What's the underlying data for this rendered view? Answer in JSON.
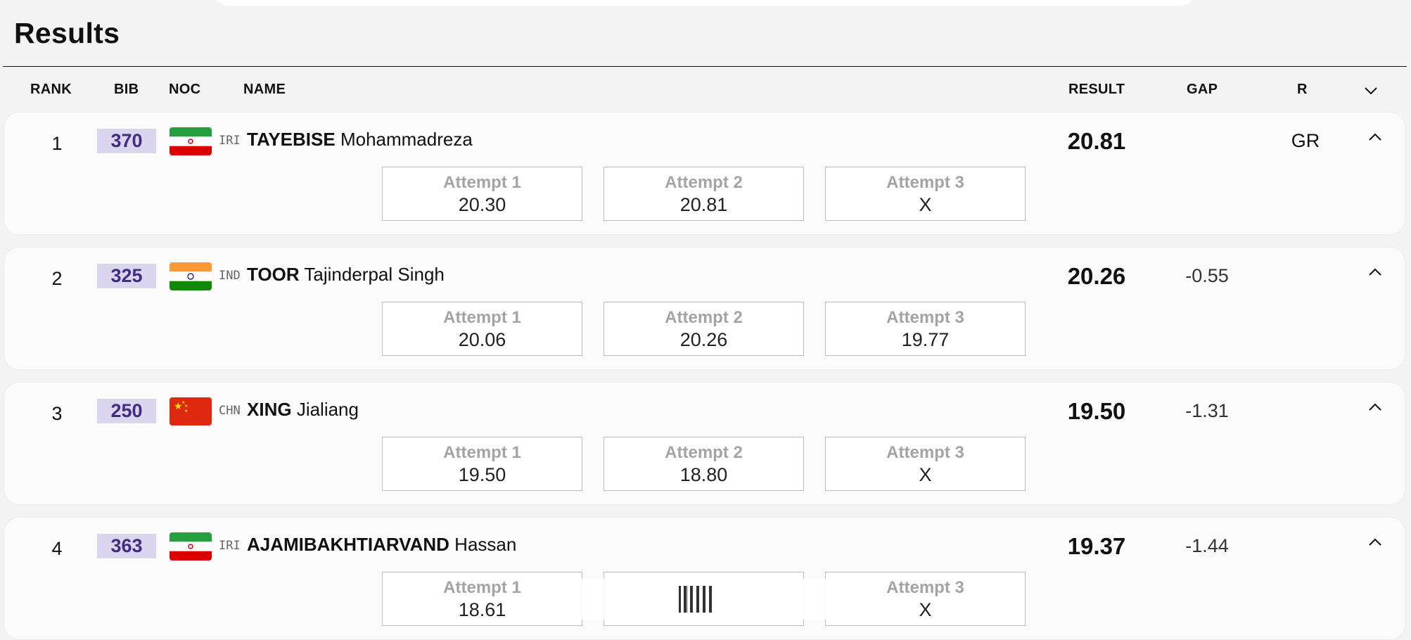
{
  "page": {
    "title": "Results"
  },
  "table": {
    "headers": {
      "rank": "RANK",
      "bib": "BIB",
      "noc": "NOC",
      "name": "NAME",
      "result": "RESULT",
      "gap": "GAP",
      "record": "R"
    },
    "header_toggle_icon": "chevron-down-icon",
    "row_toggle_icon": "chevron-up-icon",
    "rows": [
      {
        "rank": "1",
        "bib": "370",
        "noc": "IRI",
        "flag": "iran-flag-icon",
        "surname": "TAYEBISE",
        "given_name": "Mohammadreza",
        "result": "20.81",
        "gap": "",
        "record": "GR",
        "attempts": [
          {
            "label": "Attempt 1",
            "value": "20.30"
          },
          {
            "label": "Attempt 2",
            "value": "20.81"
          },
          {
            "label": "Attempt 3",
            "value": "X"
          }
        ]
      },
      {
        "rank": "2",
        "bib": "325",
        "noc": "IND",
        "flag": "india-flag-icon",
        "surname": "TOOR",
        "given_name": "Tajinderpal Singh",
        "result": "20.26",
        "gap": "-0.55",
        "record": "",
        "attempts": [
          {
            "label": "Attempt 1",
            "value": "20.06"
          },
          {
            "label": "Attempt 2",
            "value": "20.26"
          },
          {
            "label": "Attempt 3",
            "value": "19.77"
          }
        ]
      },
      {
        "rank": "3",
        "bib": "250",
        "noc": "CHN",
        "flag": "china-flag-icon",
        "surname": "XING",
        "given_name": "Jialiang",
        "result": "19.50",
        "gap": "-1.31",
        "record": "",
        "attempts": [
          {
            "label": "Attempt 1",
            "value": "19.50"
          },
          {
            "label": "Attempt 2",
            "value": "18.80"
          },
          {
            "label": "Attempt 3",
            "value": "X"
          }
        ]
      },
      {
        "rank": "4",
        "bib": "363",
        "noc": "IRI",
        "flag": "iran-flag-icon",
        "surname": "AJAMIBAKHTIARVAND",
        "given_name": "Hassan",
        "result": "19.37",
        "gap": "-1.44",
        "record": "",
        "attempts": [
          {
            "label": "Attempt 1",
            "value": "18.61"
          },
          {
            "label": "",
            "value": ""
          },
          {
            "label": "Attempt 3",
            "value": "X"
          }
        ]
      }
    ]
  },
  "colors": {
    "bib_bg": "#dcd5ee",
    "bib_text": "#3d2e83",
    "attempt_label": "#a4a4a4"
  }
}
